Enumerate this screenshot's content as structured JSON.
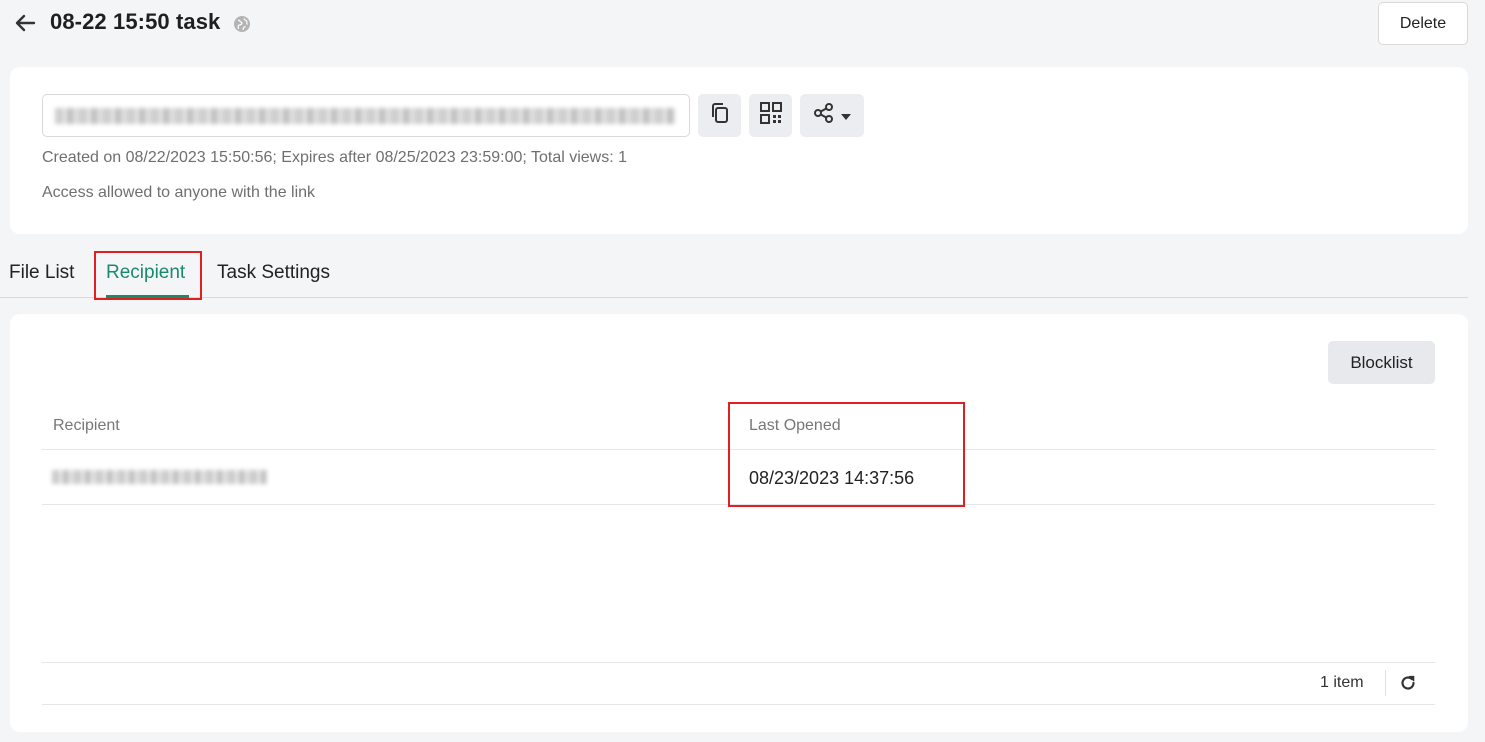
{
  "header": {
    "title": "08-22 15:50 task",
    "back_icon": "arrow-left-icon",
    "visibility_icon": "globe-icon",
    "delete_label": "Delete"
  },
  "share_panel": {
    "link_value_blurred": true,
    "copy_icon": "copy-icon",
    "qr_icon": "qr-code-icon",
    "share_icon": "share-icon",
    "created_line": "Created on 08/22/2023 15:50:56; Expires after 08/25/2023 23:59:00; Total views: 1",
    "access_line": "Access allowed to anyone with the link"
  },
  "tabs": [
    {
      "label": "File List",
      "active": false
    },
    {
      "label": "Recipient",
      "active": true
    },
    {
      "label": "Task Settings",
      "active": false
    }
  ],
  "recipients": {
    "blocklist_label": "Blocklist",
    "columns": [
      "Recipient",
      "Last Opened"
    ],
    "rows": [
      {
        "recipient_blurred": true,
        "last_opened": "08/23/2023 14:37:56"
      }
    ],
    "item_count": "1 item",
    "refresh_icon": "refresh-icon"
  },
  "colors": {
    "accent": "#1a8a6d",
    "highlight": "#e02020",
    "background": "#f4f5f7"
  }
}
